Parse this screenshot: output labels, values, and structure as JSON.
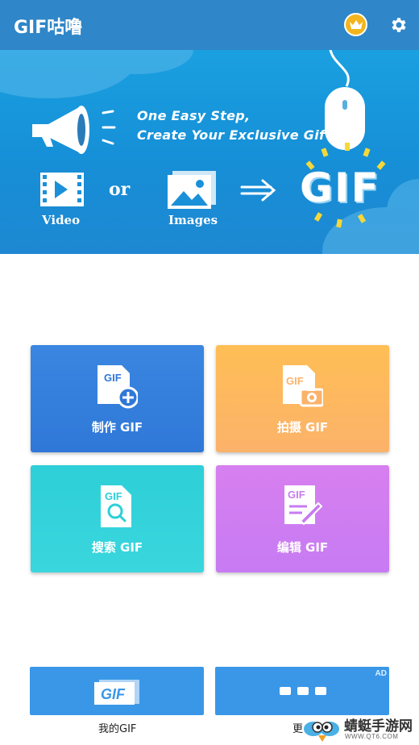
{
  "appbar": {
    "title": "GIF咕噜",
    "colors": {
      "bar": "#2f86c8",
      "crown": "#f2b51c"
    },
    "icons": [
      "crown-icon",
      "gear-icon"
    ]
  },
  "banner": {
    "tagline1": "One Easy Step,",
    "tagline2": "Create Your Exclusive Gif !",
    "video_label": "Video",
    "or_label": "or",
    "images_label": "Images",
    "gif_label": "GIF"
  },
  "tiles": [
    {
      "label": "制作 GIF",
      "icon": "gif-add-icon",
      "color": "#3a86e0",
      "badge": "GIF"
    },
    {
      "label": "拍摄 GIF",
      "icon": "gif-camera-icon",
      "color": "#ffbe55",
      "badge": "GIF"
    },
    {
      "label": "搜索 GIF",
      "icon": "gif-search-icon",
      "color": "#2ecfd8",
      "badge": "GIF"
    },
    {
      "label": "编辑 GIF",
      "icon": "gif-edit-icon",
      "color": "#d77ff0",
      "badge": "GIF"
    }
  ],
  "bottom": {
    "mygif_label": "我的GIF",
    "mygif_icon_text": "GIF",
    "more_label": "更",
    "ad_tag": "AD"
  },
  "watermark": {
    "text": "蜻蜓手游网",
    "url": "WWW.QT6.COM"
  }
}
